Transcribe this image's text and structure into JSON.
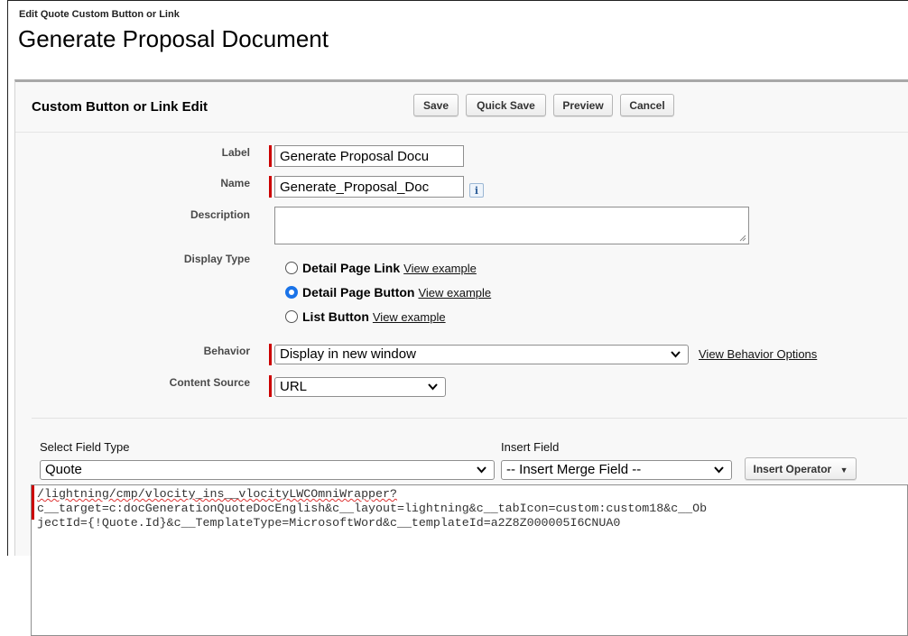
{
  "page": {
    "subtitle": "Edit Quote Custom Button or Link",
    "title": "Generate Proposal Document"
  },
  "panel": {
    "title": "Custom Button or Link Edit",
    "buttons": {
      "save": "Save",
      "quick_save": "Quick Save",
      "preview": "Preview",
      "cancel": "Cancel"
    }
  },
  "form": {
    "label": {
      "label": "Label",
      "value": "Generate Proposal Docu"
    },
    "name": {
      "label": "Name",
      "value": "Generate_Proposal_Doc",
      "info_icon": "i"
    },
    "description": {
      "label": "Description",
      "value": ""
    },
    "display_type": {
      "label": "Display Type",
      "options": [
        {
          "label": "Detail Page Link",
          "link": "View example",
          "selected": false
        },
        {
          "label": "Detail Page Button",
          "link": "View example",
          "selected": true
        },
        {
          "label": "List Button",
          "link": "View example",
          "selected": false
        }
      ]
    },
    "behavior": {
      "label": "Behavior",
      "value": "Display in new window",
      "link": "View Behavior Options"
    },
    "content_source": {
      "label": "Content Source",
      "value": "URL"
    }
  },
  "formula": {
    "select_field_type": {
      "label": "Select Field Type",
      "value": "Quote"
    },
    "insert_field": {
      "label": "Insert Field",
      "value": "-- Insert Merge Field --"
    },
    "insert_operator": "Insert Operator",
    "code_lines": [
      "/lightning/cmp/vlocity_ins__vlocityLWCOmniWrapper?",
      "c__target=c:docGenerationQuoteDocEnglish&c__layout=lightning&c__tabIcon=custom:custom18&c__Ob",
      "jectId={!Quote.Id}&c__TemplateType=MicrosoftWord&c__templateId=a2Z8Z000005I6CNUA0"
    ]
  },
  "colors": {
    "required": "#cc0000",
    "radio_selected": "#1a73e8",
    "panel_bg": "#f8f8f8"
  }
}
